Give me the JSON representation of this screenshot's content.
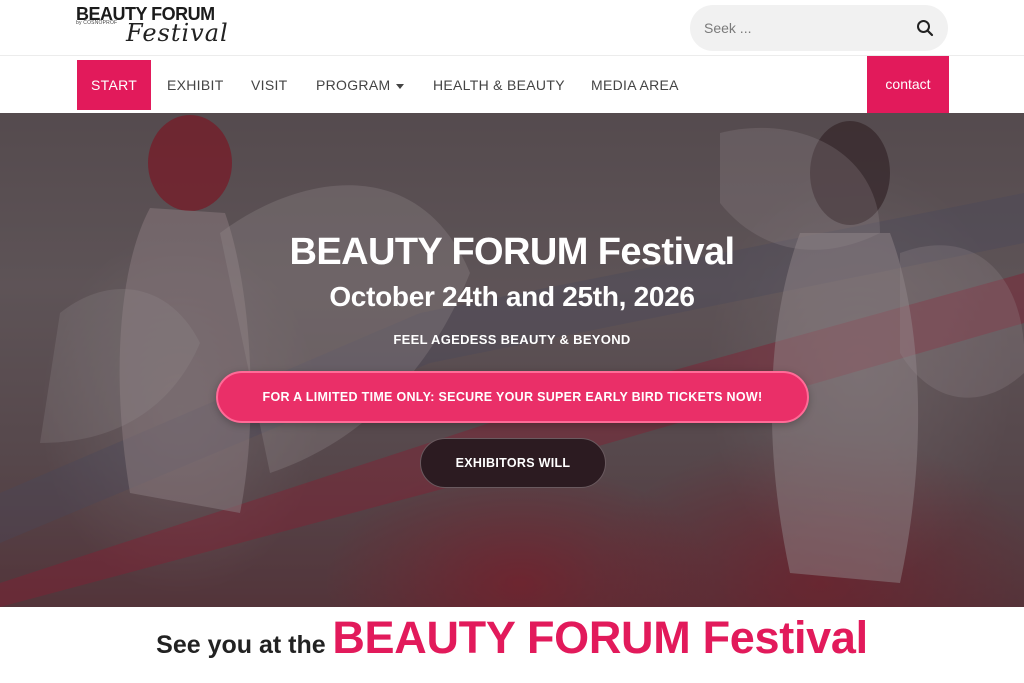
{
  "header": {
    "logo": {
      "line1": "BEAUTY FORUM",
      "line2": "by COSNOPROF",
      "line3": "Festival"
    },
    "search": {
      "placeholder": "Seek ..."
    }
  },
  "nav": {
    "items": [
      {
        "label": "START",
        "active": true
      },
      {
        "label": "EXHIBIT"
      },
      {
        "label": "VISIT"
      },
      {
        "label": "PROGRAM",
        "has_dropdown": true
      },
      {
        "label": "HEALTH & BEAUTY"
      },
      {
        "label": "MEDIA AREA"
      }
    ],
    "contact_label": "contact"
  },
  "hero": {
    "title": "BEAUTY FORUM Festival",
    "date": "October 24th and 25th, 2026",
    "tagline": "FEEL AGEDESS BEAUTY & BEYOND",
    "cta_primary": "FOR A LIMITED TIME ONLY: SECURE YOUR SUPER EARLY BIRD TICKETS NOW!",
    "cta_secondary": "EXHIBITORS WILL"
  },
  "section": {
    "lead": "See you at the",
    "highlight": "BEAUTY FORUM Festival"
  },
  "colors": {
    "accent": "#e21a5b",
    "cta": "#ea2f68",
    "dark_button": "#2c1b21"
  }
}
